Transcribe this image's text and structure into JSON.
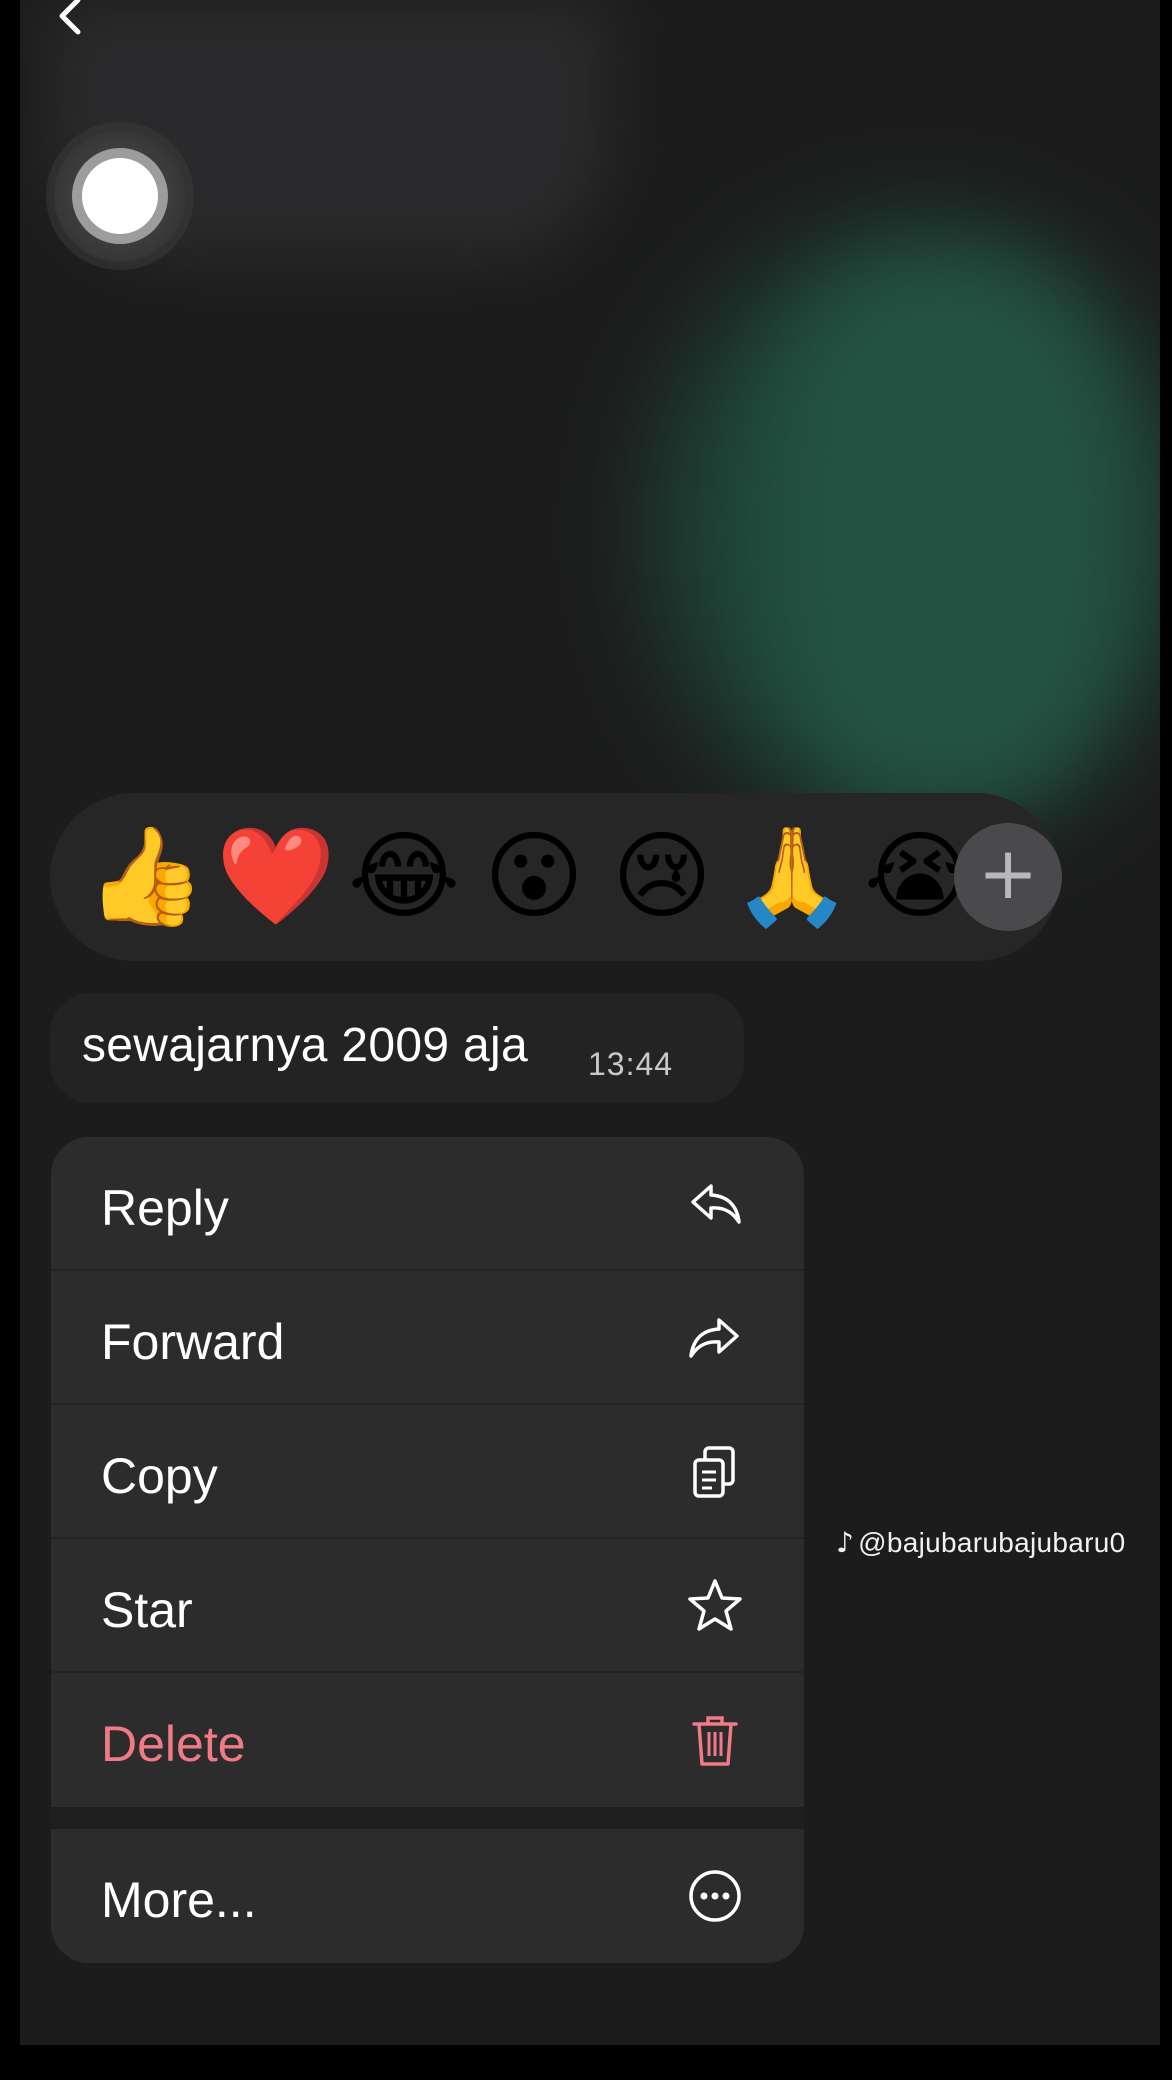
{
  "reactions": {
    "emojis": [
      "👍",
      "❤️",
      "😂",
      "😮",
      "😢",
      "🙏",
      "😭"
    ],
    "more_label": "+"
  },
  "message": {
    "text": "sewajarnya 2009 aja",
    "time": "13:44"
  },
  "menu": {
    "items": [
      {
        "label": "Reply",
        "icon": "reply-icon"
      },
      {
        "label": "Forward",
        "icon": "forward-icon"
      },
      {
        "label": "Copy",
        "icon": "copy-icon"
      },
      {
        "label": "Star",
        "icon": "star-icon"
      },
      {
        "label": "Delete",
        "icon": "trash-icon"
      },
      {
        "label": "More...",
        "icon": "ellipsis-circle-icon"
      }
    ],
    "colors": {
      "danger": "#f07a86",
      "text": "#ffffff"
    }
  },
  "watermark": {
    "handle": "@bajubarubajubaru0"
  }
}
